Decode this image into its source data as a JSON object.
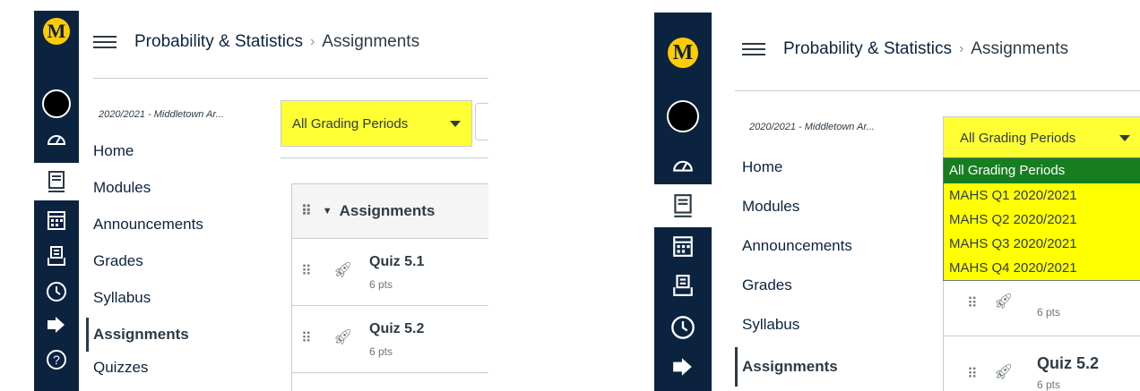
{
  "global_nav": {
    "logo_text": "M",
    "icons": [
      "avatar",
      "dashboard-icon",
      "courses-icon",
      "calendar-icon",
      "inbox-icon",
      "history-icon",
      "commons-icon",
      "help-icon"
    ]
  },
  "breadcrumb": {
    "course": "Probability & Statistics",
    "separator": "›",
    "page": "Assignments"
  },
  "course": {
    "term": "2020/2021 - Middletown Ar..."
  },
  "course_nav": {
    "items": [
      "Home",
      "Modules",
      "Announcements",
      "Grades",
      "Syllabus",
      "Assignments",
      "Quizzes"
    ],
    "active": "Assignments"
  },
  "grading_period": {
    "selected": "All Grading Periods",
    "options": [
      "All Grading Periods",
      "MAHS Q1 2020/2021",
      "MAHS Q2 2020/2021",
      "MAHS Q3 2020/2021",
      "MAHS Q4 2020/2021"
    ]
  },
  "assignments": {
    "group_title": "Assignments",
    "items": [
      {
        "title": "Quiz 5.1",
        "points": "6 pts"
      },
      {
        "title": "Quiz 5.2",
        "points": "6 pts"
      }
    ]
  },
  "colors": {
    "nav_bg": "#0c2340",
    "logo_yellow": "#ffcb05",
    "highlight": "#ffff33",
    "selected_option": "#177e1f"
  }
}
